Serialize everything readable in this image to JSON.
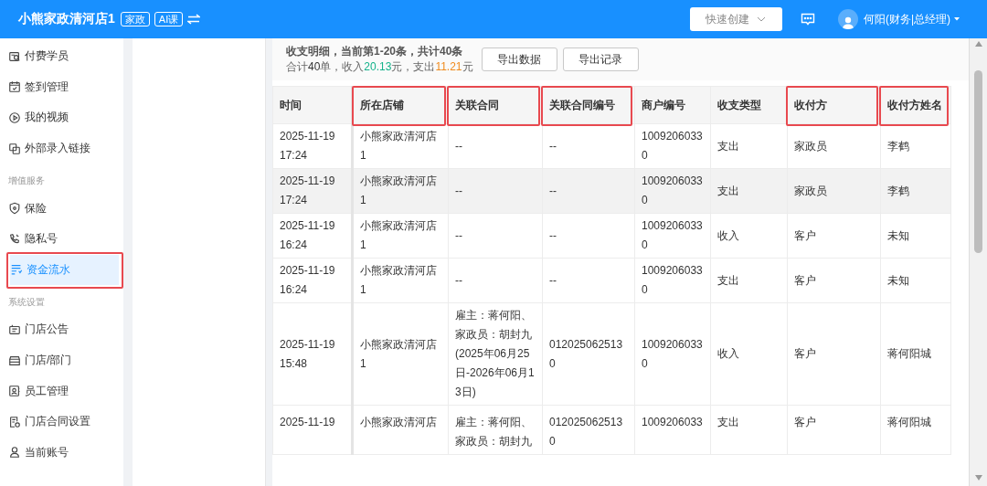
{
  "topbar": {
    "store_name": "小熊家政清河店1",
    "tags": [
      "家政",
      "AI课"
    ],
    "quick_create": "快速创建",
    "user_name": "何阳(财务|总经理)"
  },
  "sidebar": {
    "sections": [
      {
        "items": [
          {
            "label": "付费学员",
            "selected": false,
            "highlighted": false
          },
          {
            "label": "签到管理",
            "selected": false,
            "highlighted": false
          },
          {
            "label": "我的视频",
            "selected": false,
            "highlighted": false
          },
          {
            "label": "外部录入链接",
            "selected": false,
            "highlighted": false
          }
        ]
      },
      {
        "title": "增值服务",
        "items": [
          {
            "label": "保险",
            "selected": false,
            "highlighted": false
          },
          {
            "label": "隐私号",
            "selected": false,
            "highlighted": false
          },
          {
            "label": "资金流水",
            "selected": true,
            "highlighted": true
          }
        ]
      },
      {
        "title": "系统设置",
        "items": [
          {
            "label": "门店公告",
            "selected": false,
            "highlighted": false
          },
          {
            "label": "门店/部门",
            "selected": false,
            "highlighted": false
          },
          {
            "label": "员工管理",
            "selected": false,
            "highlighted": false
          },
          {
            "label": "门店合同设置",
            "selected": false,
            "highlighted": false
          },
          {
            "label": "当前账号",
            "selected": false,
            "highlighted": false
          }
        ]
      }
    ]
  },
  "summary": {
    "title": "收支明细，当前第1-20条，共计40条",
    "totals": [
      {
        "text": "合计",
        "kind": "plain"
      },
      {
        "text": "40",
        "kind": "count"
      },
      {
        "text": "单，收入",
        "kind": "plain"
      },
      {
        "text": "20.13",
        "kind": "income"
      },
      {
        "text": "元，支出",
        "kind": "plain"
      },
      {
        "text": "11.21",
        "kind": "expense"
      },
      {
        "text": "元",
        "kind": "plain"
      }
    ],
    "buttons": [
      "导出数据",
      "导出记录"
    ]
  },
  "table": {
    "columns": [
      {
        "label": "时间",
        "highlighted": false
      },
      {
        "label": "所在店铺",
        "highlighted": true
      },
      {
        "label": "关联合同",
        "highlighted": true
      },
      {
        "label": "关联合同编号",
        "highlighted": true
      },
      {
        "label": "商户编号",
        "highlighted": false
      },
      {
        "label": "收支类型",
        "highlighted": false
      },
      {
        "label": "收付方",
        "highlighted": true
      },
      {
        "label": "收付方姓名",
        "highlighted": true
      }
    ],
    "rows": [
      {
        "hovered": false,
        "cells": [
          "2025-11-19 17:24",
          "小熊家政清河店1",
          "--",
          "--",
          "10092060330",
          "支出",
          "家政员",
          "李鹤"
        ]
      },
      {
        "hovered": true,
        "cells": [
          "2025-11-19 17:24",
          "小熊家政清河店1",
          "--",
          "--",
          "10092060330",
          "支出",
          "家政员",
          "李鹤"
        ]
      },
      {
        "hovered": false,
        "cells": [
          "2025-11-19 16:24",
          "小熊家政清河店1",
          "--",
          "--",
          "10092060330",
          "收入",
          "客户",
          "未知"
        ]
      },
      {
        "hovered": false,
        "cells": [
          "2025-11-19 16:24",
          "小熊家政清河店1",
          "--",
          "--",
          "10092060330",
          "支出",
          "客户",
          "未知"
        ]
      },
      {
        "hovered": false,
        "cells": [
          "2025-11-19 15:48",
          "小熊家政清河店1",
          "雇主：蒋何阳、家政员：胡封九(2025年06月25日-2026年06月13日)",
          "0120250625130",
          "10092060330",
          "收入",
          "客户",
          "蒋何阳城"
        ]
      },
      {
        "hovered": false,
        "cells": [
          "2025-11-19",
          "小熊家政清河店",
          "雇主：蒋何阳、家政员：胡封九",
          "0120250625130",
          "1009206033",
          "支出",
          "客户",
          "蒋何阳城"
        ]
      }
    ]
  }
}
